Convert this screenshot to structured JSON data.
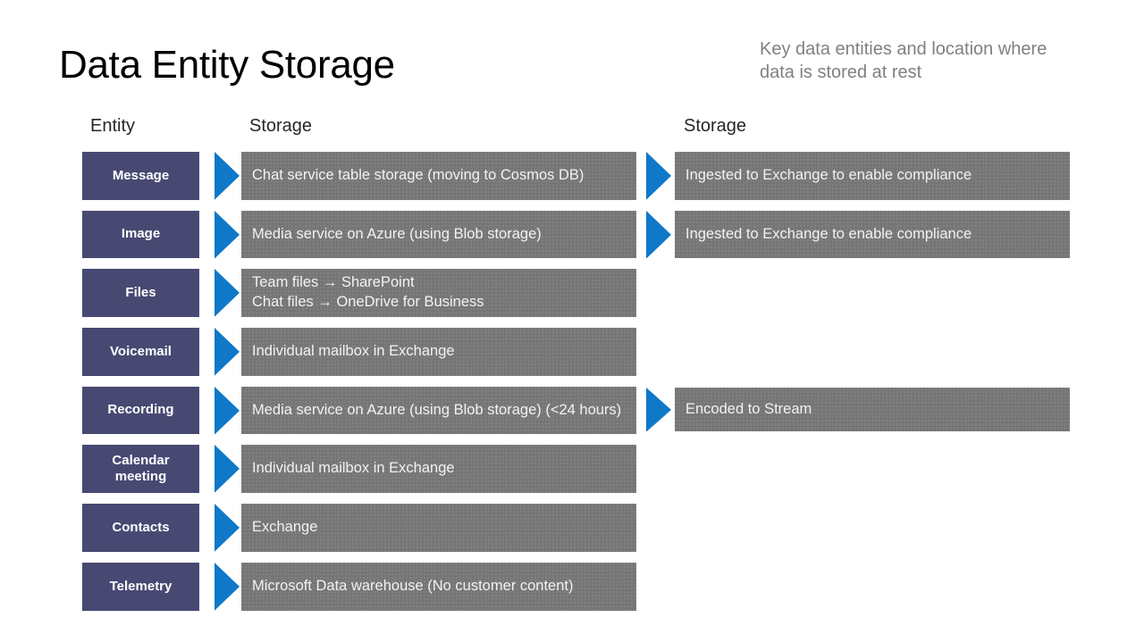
{
  "header": {
    "title": "Data Entity Storage",
    "subtitle": "Key data entities and location where data is stored at rest"
  },
  "columns": {
    "entity": "Entity",
    "storage_primary": "Storage",
    "storage_secondary": "Storage"
  },
  "colors": {
    "entity_box": "#474973",
    "storage_box": "#767676",
    "arrow": "#0f78c8",
    "title_text": "#000000",
    "subtitle_text": "#808080",
    "box_text": "#ffffff"
  },
  "icons": {
    "arrow": "right-arrow-icon",
    "inline_arrow": "→"
  },
  "rows": [
    {
      "entity": "Message",
      "storage_primary": "Chat service table storage (moving to Cosmos DB)",
      "storage_secondary": "Ingested to Exchange to enable compliance"
    },
    {
      "entity": "Image",
      "storage_primary": "Media service on Azure (using Blob storage)",
      "storage_secondary": "Ingested to Exchange to enable compliance"
    },
    {
      "entity": "Files",
      "storage_primary": "Team files → SharePoint\nChat files → OneDrive for Business",
      "storage_secondary": null
    },
    {
      "entity": "Voicemail",
      "storage_primary": "Individual mailbox in Exchange",
      "storage_secondary": null
    },
    {
      "entity": "Recording",
      "storage_primary": "Media service on Azure (using Blob storage) (<24 hours)",
      "storage_secondary": "Encoded to Stream"
    },
    {
      "entity": "Calendar meeting",
      "storage_primary": "Individual mailbox in Exchange",
      "storage_secondary": null
    },
    {
      "entity": "Contacts",
      "storage_primary": "Exchange",
      "storage_secondary": null
    },
    {
      "entity": "Telemetry",
      "storage_primary": "Microsoft Data warehouse (No customer content)",
      "storage_secondary": null
    }
  ]
}
